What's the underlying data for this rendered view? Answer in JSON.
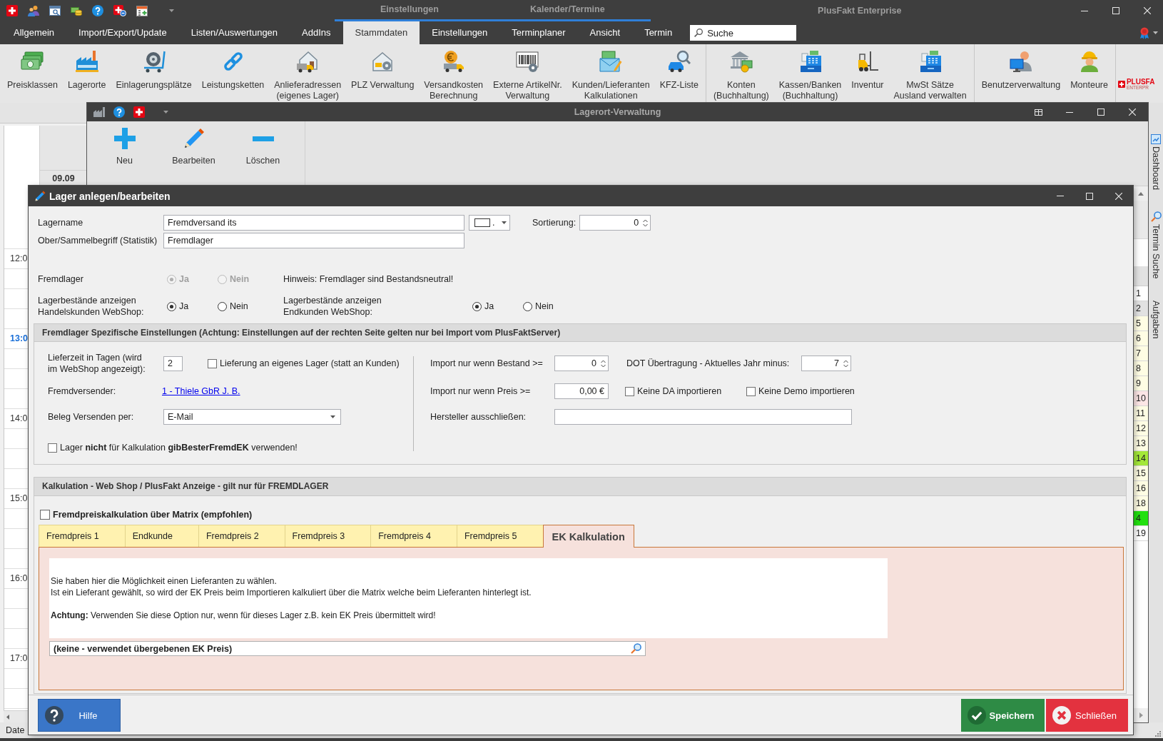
{
  "title_bar": {
    "context_groups": [
      {
        "label": "Einstellungen"
      },
      {
        "label": "Kalender/Termine"
      }
    ],
    "title": "PlusFakt Enterprise"
  },
  "menu": {
    "tabs": [
      {
        "label": "Allgemein",
        "selected": false
      },
      {
        "label": "Import/Export/Update",
        "selected": false
      },
      {
        "label": "Listen/Auswertungen",
        "selected": false
      },
      {
        "label": "AddIns",
        "selected": false
      },
      {
        "label": "Stammdaten",
        "selected": true
      },
      {
        "label": "Einstellungen",
        "selected": false
      },
      {
        "label": "Terminplaner",
        "selected": false
      },
      {
        "label": "Ansicht",
        "selected": false
      },
      {
        "label": "Termin",
        "selected": false
      }
    ],
    "search": {
      "placeholder": "Suche"
    }
  },
  "ribbon": {
    "groups": [
      {
        "items": [
          {
            "label": "Preisklassen"
          },
          {
            "label": "Lagerorte"
          },
          {
            "label": "Einlagerungsplätze"
          },
          {
            "label": "Leistungsketten"
          },
          {
            "label": "Anlieferadressen\n(eigenes Lager)"
          },
          {
            "label": "PLZ Verwaltung"
          },
          {
            "label": "Versandkosten\nBerechnung"
          },
          {
            "label": "Externe ArtikelNr.\nVerwaltung"
          },
          {
            "label": "Kunden/Lieferanten\nKalkulationen"
          },
          {
            "label": "KFZ-Liste"
          }
        ]
      },
      {
        "items": [
          {
            "label": "Konten\n(Buchhaltung)"
          },
          {
            "label": "Kassen/Banken\n(Buchhaltung)"
          },
          {
            "label": "Inventur"
          },
          {
            "label": "MwSt Sätze\nAusland verwalten"
          }
        ]
      },
      {
        "items": [
          {
            "label": "Benutzerverwaltung"
          },
          {
            "label": "Monteure"
          }
        ]
      }
    ],
    "logo": {
      "wordmark": "PLUSFA",
      "subtitle": "ENTERPR"
    }
  },
  "calendar": {
    "day_header": "09.09",
    "hours": [
      {
        "label": "12:0",
        "current": false
      },
      {
        "label": "13:0",
        "current": true
      },
      {
        "label": "14:0",
        "current": false
      },
      {
        "label": "15:0",
        "current": false
      },
      {
        "label": "16:0",
        "current": false
      },
      {
        "label": "17:0",
        "current": false
      }
    ]
  },
  "side_tabs": [
    {
      "label": "Dashboard"
    },
    {
      "label": "Termin Suche"
    },
    {
      "label": "Aufgaben"
    }
  ],
  "status_bar": {
    "text": "Date"
  },
  "lagerort_window": {
    "title": "Lagerort-Verwaltung",
    "toolbar": [
      {
        "label": "Neu"
      },
      {
        "label": "Bearbeiten"
      },
      {
        "label": "Löschen"
      }
    ],
    "sort_cells": [
      {
        "text": "1",
        "color": "#ffffff"
      },
      {
        "text": "2",
        "color": "#e2e2e2"
      },
      {
        "text": "5",
        "color": "#fffde4"
      },
      {
        "text": "6",
        "color": "#fffde4"
      },
      {
        "text": "7",
        "color": "#fffde4"
      },
      {
        "text": "8",
        "color": "#fffde4"
      },
      {
        "text": "9",
        "color": "#fffde4"
      },
      {
        "text": "10",
        "color": "#fde6e6"
      },
      {
        "text": "11",
        "color": "#fffde4"
      },
      {
        "text": "12",
        "color": "#fffde4"
      },
      {
        "text": "13",
        "color": "#fffde4"
      },
      {
        "text": "14",
        "color": "#a4e83a"
      },
      {
        "text": "15",
        "color": "#fffde4"
      },
      {
        "text": "16",
        "color": "#fffde4"
      },
      {
        "text": "18",
        "color": "#fffde4"
      },
      {
        "text": "4",
        "color": "#22e010"
      },
      {
        "text": "19",
        "color": "#ffffff"
      }
    ]
  },
  "dialog": {
    "title": "Lager anlegen/bearbeiten",
    "lagername": {
      "label": "Lagername",
      "value": "Fremdversand its"
    },
    "color_select": {
      "text": "."
    },
    "sortierung": {
      "label": "Sortierung:",
      "value": "0"
    },
    "oberbegriff": {
      "label": "Ober/Sammelbegriff (Statistik)",
      "value": "Fremdlager"
    },
    "fremdlager": {
      "label": "Fremdlager",
      "options": [
        {
          "label": "Ja",
          "selected": true,
          "disabled": true
        },
        {
          "label": "Nein",
          "selected": false,
          "disabled": true
        }
      ],
      "note": "Hinweis: Fremdlager sind Bestandsneutral!"
    },
    "bestand_handel": {
      "label": "Lagerbestände anzeigen\nHandelskunden WebShop:",
      "options": [
        {
          "label": "Ja",
          "selected": true,
          "disabled": false
        },
        {
          "label": "Nein",
          "selected": false,
          "disabled": false
        }
      ]
    },
    "bestand_endkunden": {
      "label": "Lagerbestände anzeigen\nEndkunden WebShop:",
      "options": [
        {
          "label": "Ja",
          "selected": true,
          "disabled": false
        },
        {
          "label": "Nein",
          "selected": false,
          "disabled": false
        }
      ]
    },
    "fremdlager_settings": {
      "title": "Fremdlager Spezifische Einstellungen (Achtung: Einstellungen auf der rechten Seite gelten nur bei Import vom PlusFaktServer)",
      "lieferzeit": {
        "label": "Lieferzeit in Tagen (wird\nim WebShop angezeigt):",
        "value": "2"
      },
      "eigenes_lager": {
        "label": "Lieferung an eigenes Lager (statt an Kunden)",
        "checked": false
      },
      "fremdversender": {
        "label": "Fremdversender:",
        "link": "1 - Thiele GbR J. B."
      },
      "beleg_versand": {
        "label": "Beleg Versenden per:",
        "value": "E-Mail"
      },
      "nicht_kalkulation": {
        "label": "Lager **nicht** für Kalkulation **gibBesterFremdEK** verwenden!",
        "checked": false
      },
      "import_bestand": {
        "label": "Import nur wenn Bestand >=",
        "value": "0"
      },
      "dot_jahr": {
        "label": "DOT Übertragung - Aktuelles Jahr minus:",
        "value": "7"
      },
      "import_preis": {
        "label": "Import nur wenn Preis >=",
        "value": "0,00 €"
      },
      "keine_da": {
        "label": "Keine DA importieren",
        "checked": false
      },
      "keine_demo": {
        "label": "Keine Demo importieren",
        "checked": false
      },
      "hersteller": {
        "label": "Hersteller ausschließen:"
      }
    },
    "kalkulation": {
      "title": "Kalkulation - Web Shop / PlusFakt Anzeige - gilt nur für FREMDLAGER",
      "matrix": {
        "label": "Fremdpreiskalkulation über Matrix (empfohlen)",
        "checked": false
      },
      "tabs": [
        {
          "label": "Fremdpreis 1",
          "selected": false
        },
        {
          "label": "Endkunde",
          "selected": false
        },
        {
          "label": "Fremdpreis 2",
          "selected": false
        },
        {
          "label": "Fremdpreis 3",
          "selected": false
        },
        {
          "label": "Fremdpreis 4",
          "selected": false
        },
        {
          "label": "Fremdpreis 5",
          "selected": false
        },
        {
          "label": "EK Kalkulation",
          "selected": true
        }
      ],
      "info": [
        "Sie haben hier die Möglichkeit einen Lieferanten zu wählen.\nIst ein Lieferant gewählt, so wird der EK Preis beim Importieren kalkuliert über die Matrix welche beim Lieferanten hinterlegt ist.",
        "**Achtung:** Verwenden Sie diese Option nur, wenn für dieses Lager z.B. kein EK Preis übermittelt wird!"
      ],
      "lieferant": {
        "value": "(keine - verwendet übergebenen EK Preis)"
      }
    },
    "buttons": [
      {
        "label": "Hilfe",
        "kind": "help"
      },
      {
        "label": "Speichern",
        "kind": "save"
      },
      {
        "label": "Schließen",
        "kind": "close"
      }
    ]
  }
}
